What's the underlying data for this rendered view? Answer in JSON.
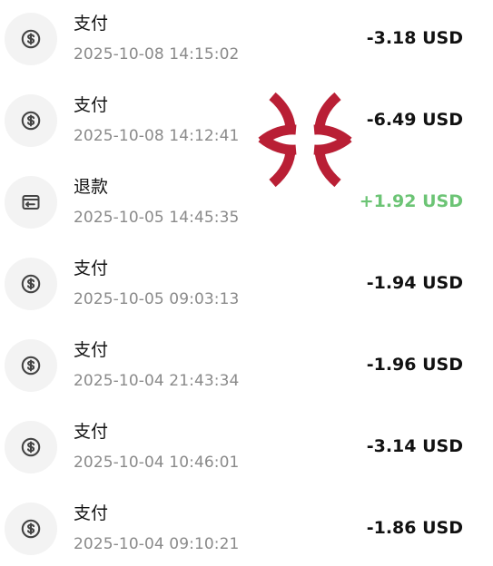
{
  "colors": {
    "negative": "#111111",
    "positive": "#6cc475",
    "accent_red": "#b91f35",
    "icon_bg": "#f3f3f3",
    "icon_stroke": "#444444"
  },
  "transactions": [
    {
      "type": "支付",
      "time": "2025-10-08 14:15:02",
      "amount": "-3.18 USD",
      "icon": "dollar-circle-icon"
    },
    {
      "type": "支付",
      "time": "2025-10-08 14:12:41",
      "amount": "-6.49 USD",
      "icon": "dollar-circle-icon"
    },
    {
      "type": "退款",
      "time": "2025-10-05 14:45:35",
      "amount": "+1.92 USD",
      "icon": "refund-card-icon"
    },
    {
      "type": "支付",
      "time": "2025-10-05 09:03:13",
      "amount": "-1.94 USD",
      "icon": "dollar-circle-icon"
    },
    {
      "type": "支付",
      "time": "2025-10-04 21:43:34",
      "amount": "-1.96 USD",
      "icon": "dollar-circle-icon"
    },
    {
      "type": "支付",
      "time": "2025-10-04 10:46:01",
      "amount": "-3.14 USD",
      "icon": "dollar-circle-icon"
    },
    {
      "type": "支付",
      "time": "2025-10-04 09:10:21",
      "amount": "-1.86 USD",
      "icon": "dollar-circle-icon"
    }
  ],
  "overlay": {
    "icon": "anger-symbol-icon"
  }
}
